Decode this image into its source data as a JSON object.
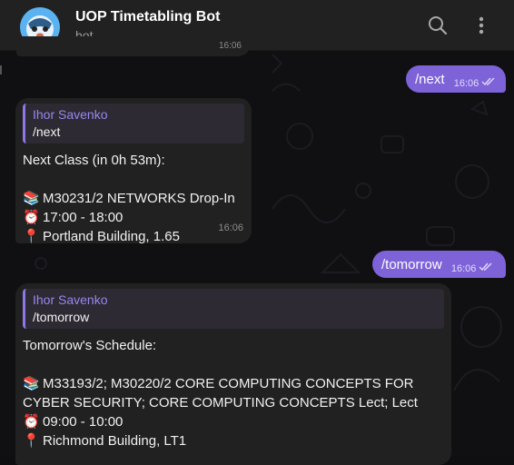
{
  "header": {
    "title": "UOP Timetabling Bot",
    "subtitle": "bot",
    "icons": {
      "search": "search-icon",
      "menu": "more-vertical-icon"
    }
  },
  "messages": {
    "top_stub_time": "16:06",
    "out_next": {
      "text": "/next",
      "time": "16:06",
      "status": "double-check-icon"
    },
    "in_next": {
      "reply_author": "Ihor Savenko",
      "reply_text": "/next",
      "lines": [
        "Next Class (in 0h 53m):",
        "",
        "M30231/2 NETWORKS Drop-In",
        "17:00 - 18:00",
        "Portland Building, 1.65"
      ],
      "emojis": [
        "books-icon",
        "alarm-clock-icon",
        "pin-icon"
      ],
      "time": "16:06"
    },
    "out_tomorrow": {
      "text": "/tomorrow",
      "time": "16:06",
      "status": "double-check-icon"
    },
    "in_tomorrow": {
      "reply_author": "Ihor Savenko",
      "reply_text": "/tomorrow",
      "lines": [
        "Tomorrow's Schedule:",
        "",
        "M33193/2; M30220/2 CORE COMPUTING CONCEPTS FOR",
        "CYBER SECURITY; CORE COMPUTING CONCEPTS Lect; Lect",
        "09:00 - 10:00",
        "Richmond Building, LT1"
      ]
    }
  },
  "colors": {
    "outgoing_bubble": "#7d62d8",
    "incoming_bubble": "#212121",
    "reply_accent": "#8f76e8",
    "header_bg": "#212121"
  }
}
